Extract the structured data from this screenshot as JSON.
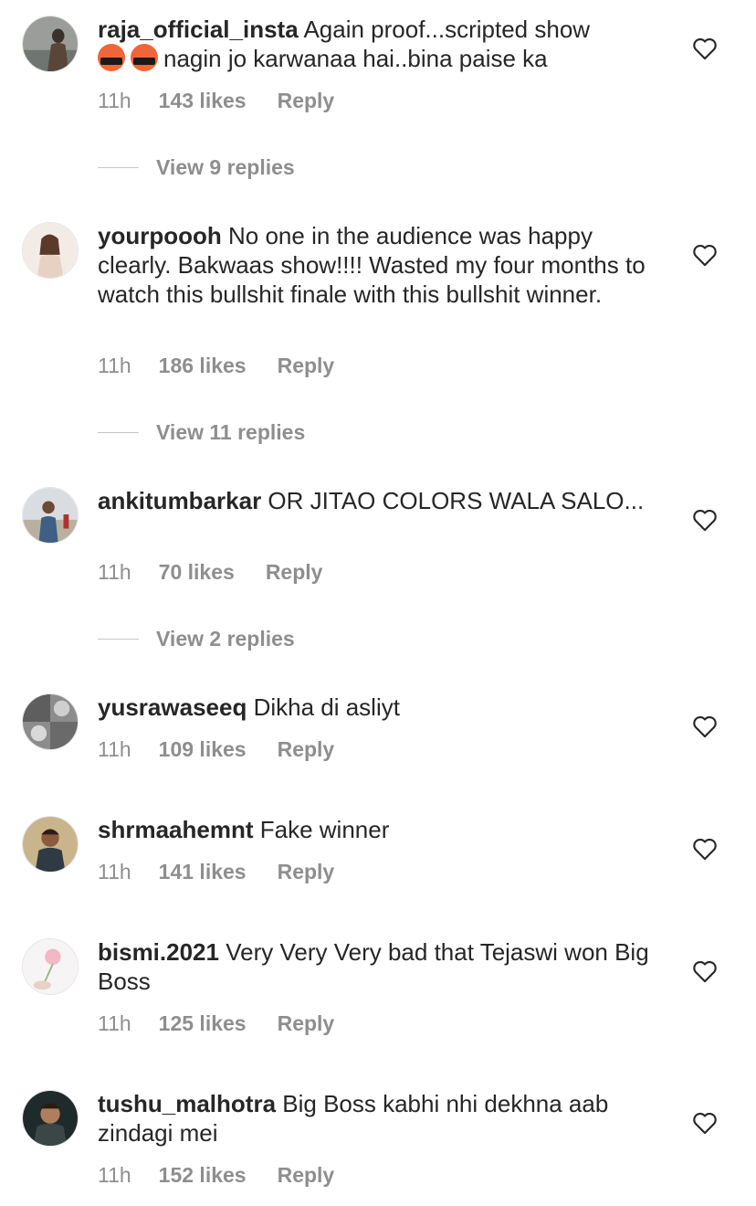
{
  "comments": [
    {
      "username": "raja_official_insta",
      "text_pre": "Again proof...scripted show",
      "text_post": "nagin jo karwanaa hai..bina paise ka",
      "emojis": [
        "angry-swearing-emoji",
        "angry-swearing-emoji"
      ],
      "time": "11h",
      "likes": "143 likes",
      "reply": "Reply",
      "view_replies": "View 9 replies"
    },
    {
      "username": "yourpoooh",
      "text": "No one in the audience was happy clearly. Bakwaas show!!!! Wasted my four months to watch this bullshit finale with this bullshit winner.",
      "time": "11h",
      "likes": "186 likes",
      "reply": "Reply",
      "view_replies": "View 11 replies"
    },
    {
      "username": "ankitumbarkar",
      "text": "OR JITAO COLORS WALA SALO...",
      "time": "11h",
      "likes": "70 likes",
      "reply": "Reply",
      "view_replies": "View 2 replies"
    },
    {
      "username": "yusrawaseeq",
      "text": "Dikha di asliyt",
      "time": "11h",
      "likes": "109 likes",
      "reply": "Reply"
    },
    {
      "username": "shrmaahemnt",
      "text": "Fake winner",
      "time": "11h",
      "likes": "141 likes",
      "reply": "Reply"
    },
    {
      "username": "bismi.2021",
      "text": "Very Very Very bad that Tejaswi won Big Boss",
      "time": "11h",
      "likes": "125 likes",
      "reply": "Reply"
    },
    {
      "username": "tushu_malhotra",
      "text": "Big Boss kabhi nhi dekhna aab zindagi mei",
      "time": "11h",
      "likes": "152 likes",
      "reply": "Reply"
    }
  ],
  "icons": {
    "like": "heart-outline-icon"
  },
  "colors": {
    "text": "#262626",
    "muted": "#8e8e8e",
    "emoji": "#f0663a"
  }
}
